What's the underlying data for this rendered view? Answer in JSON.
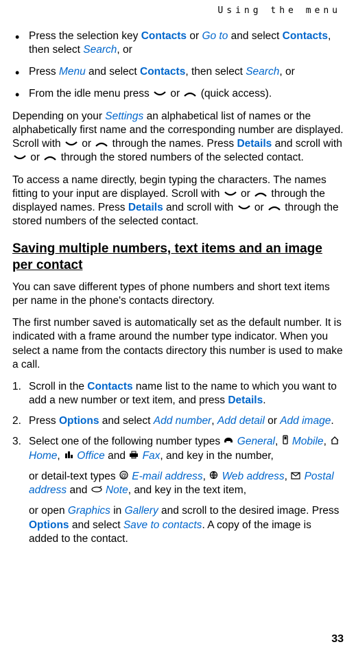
{
  "header": {
    "section": "Using the menu"
  },
  "bullets": {
    "b1_pre": "Press the selection key ",
    "b1_contacts": "Contacts",
    "b1_or1": " or ",
    "b1_goto": "Go to",
    "b1_and": " and select ",
    "b1_contacts2": "Contacts",
    "b1_then": ", then select ",
    "b1_search": "Search",
    "b1_end": ", or",
    "b2_pre": "Press ",
    "b2_menu": "Menu",
    "b2_and": " and select ",
    "b2_contacts": "Contacts",
    "b2_then": ", then select ",
    "b2_search": "Search",
    "b2_end": ", or",
    "b3_pre": "From the idle menu press ",
    "b3_or": " or ",
    "b3_end": " (quick access)."
  },
  "p1": {
    "pre": "Depending on your ",
    "settings": "Settings",
    "mid1": " an alphabetical list of names or the alphabetically first name and the corresponding number are displayed. Scroll with ",
    "or1": " or ",
    "mid2": " through the names. Press ",
    "details": "Details",
    "mid3": " and scroll with ",
    "or2": " or ",
    "end": " through the stored numbers of the selected contact."
  },
  "p2": {
    "pre": "To access a name directly, begin typing the characters. The names fitting to your input are displayed. Scroll with ",
    "or1": " or ",
    "mid1": " through the displayed names. Press ",
    "details": "Details",
    "mid2": " and scroll with ",
    "or2": " or ",
    "end": " through the stored numbers of the selected contact."
  },
  "heading": "Saving multiple numbers, text items and an image per contact",
  "p3": "You can save different types of phone numbers and short text items per name in the phone's contacts directory.",
  "p4": "The first number saved is automatically set as the default number. It is indicated with a frame around the number type indicator. When you select a name from the contacts directory this number is used to make a call.",
  "steps": {
    "s1_num": "1.",
    "s1_pre": "Scroll in the ",
    "s1_contacts": "Contacts",
    "s1_mid": " name list to the name to which you want to add a new number or text item, and press ",
    "s1_details": "Details",
    "s1_end": ".",
    "s2_num": "2.",
    "s2_pre": "Press ",
    "s2_options": "Options",
    "s2_and": " and select ",
    "s2_addnum": "Add number",
    "s2_c1": ", ",
    "s2_adddetail": "Add detail",
    "s2_or": " or ",
    "s2_addimage": "Add image",
    "s2_end": ".",
    "s3_num": "3.",
    "s3_pre": "Select one of the following number types ",
    "s3_general": "General",
    "s3_c1": ", ",
    "s3_mobile": "Mobile",
    "s3_c2": ", ",
    "s3_home": "Home",
    "s3_c3": ", ",
    "s3_office": "Office",
    "s3_and": " and ",
    "s3_fax": "Fax",
    "s3_end": ", and key in the number,",
    "s3b_pre": "or detail-text types ",
    "s3b_email": "E-mail address",
    "s3b_c1": ", ",
    "s3b_web": "Web address",
    "s3b_c2": ", ",
    "s3b_postal": "Postal address",
    "s3b_and": " and ",
    "s3b_note": "Note",
    "s3b_end": ", and key in the text item,",
    "s3c_pre": "or open ",
    "s3c_graphics": "Graphics",
    "s3c_in": " in ",
    "s3c_gallery": "Gallery",
    "s3c_mid": " and scroll to the desired image. Press ",
    "s3c_options": "Options",
    "s3c_and": " and select ",
    "s3c_save": "Save to contacts",
    "s3c_end": ". A copy of the image is added to the contact."
  },
  "pageNum": "33"
}
